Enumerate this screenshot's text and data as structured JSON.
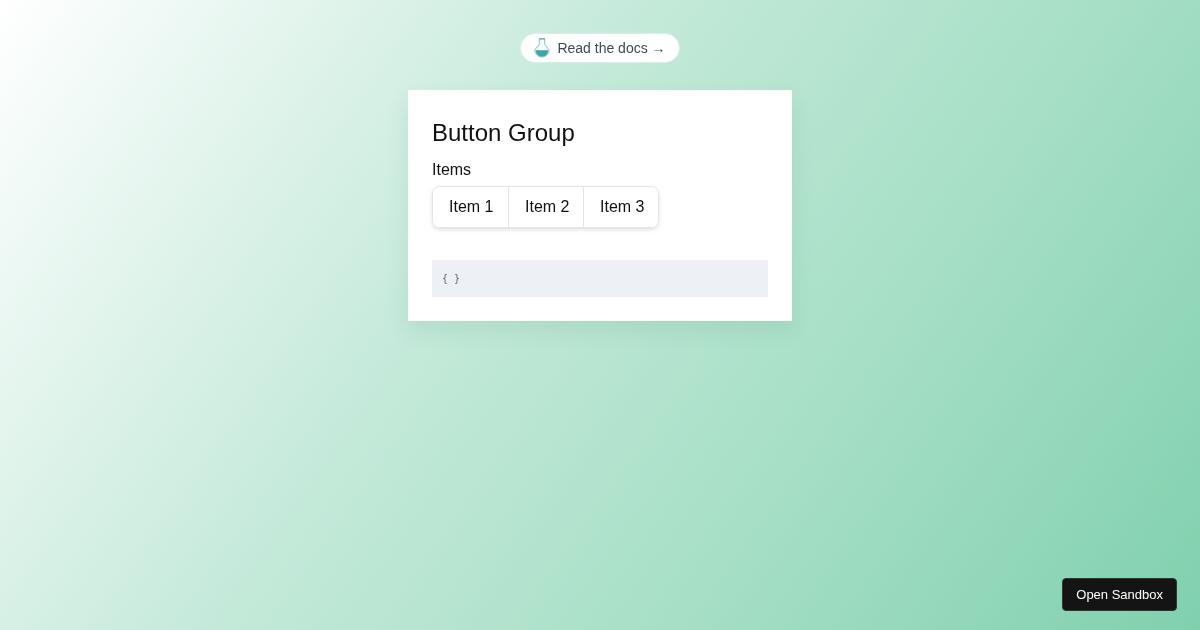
{
  "docs_link": {
    "label": "Read the docs →"
  },
  "card": {
    "title": "Button Group",
    "field_label": "Items",
    "buttons": [
      {
        "label": "Item 1"
      },
      {
        "label": "Item 2"
      },
      {
        "label": "Item 3"
      }
    ],
    "code": "{ }"
  },
  "sandbox_button": {
    "label": "Open Sandbox"
  }
}
